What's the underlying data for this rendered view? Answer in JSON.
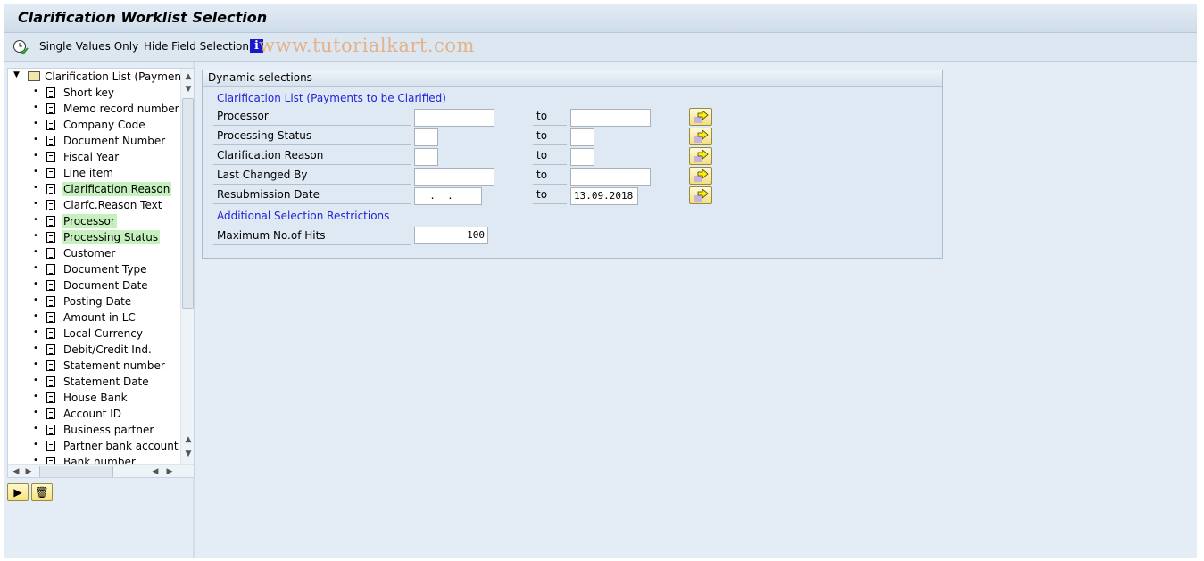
{
  "title": "Clarification Worklist Selection",
  "toolbar": {
    "single_values": "Single Values Only",
    "hide_field": "Hide Field Selection",
    "watermark": "www.tutorialkart.com"
  },
  "tree": {
    "root": "Clarification List (Payments to be Clarified)",
    "items": [
      {
        "label": "Short key",
        "hl": false
      },
      {
        "label": "Memo record number",
        "hl": false
      },
      {
        "label": "Company Code",
        "hl": false
      },
      {
        "label": "Document Number",
        "hl": false
      },
      {
        "label": "Fiscal Year",
        "hl": false
      },
      {
        "label": "Line item",
        "hl": false
      },
      {
        "label": "Clarification Reason",
        "hl": true
      },
      {
        "label": "Clarfc.Reason Text",
        "hl": false
      },
      {
        "label": "Processor",
        "hl": true
      },
      {
        "label": "Processing Status",
        "hl": true
      },
      {
        "label": "Customer",
        "hl": false
      },
      {
        "label": "Document Type",
        "hl": false
      },
      {
        "label": "Document Date",
        "hl": false
      },
      {
        "label": "Posting Date",
        "hl": false
      },
      {
        "label": "Amount in LC",
        "hl": false
      },
      {
        "label": "Local Currency",
        "hl": false
      },
      {
        "label": "Debit/Credit Ind.",
        "hl": false
      },
      {
        "label": "Statement number",
        "hl": false
      },
      {
        "label": "Statement Date",
        "hl": false
      },
      {
        "label": "House Bank",
        "hl": false
      },
      {
        "label": "Account ID",
        "hl": false
      },
      {
        "label": "Business partner",
        "hl": false
      },
      {
        "label": "Partner bank account",
        "hl": false
      },
      {
        "label": "Bank number",
        "hl": false
      }
    ]
  },
  "panel": {
    "header": "Dynamic selections",
    "section1": "Clarification List (Payments to be Clarified)",
    "to_label": "to",
    "fields": [
      {
        "label": "Processor",
        "from": "",
        "to": "",
        "wide": true
      },
      {
        "label": "Processing Status",
        "from": "",
        "to": "",
        "wide": false
      },
      {
        "label": "Clarification Reason",
        "from": "",
        "to": "",
        "wide": false
      },
      {
        "label": "Last Changed By",
        "from": "",
        "to": "",
        "wide": true
      },
      {
        "label": "Resubmission Date",
        "from": "  .  .",
        "to": "13.09.2018",
        "wide": "date"
      }
    ],
    "section2": "Additional Selection Restrictions",
    "max_hits_label": "Maximum No.of Hits",
    "max_hits": "100"
  },
  "colors": {
    "highlight": "#c6f0bd",
    "section_text": "#2323d8",
    "background": "#e4edf5"
  }
}
